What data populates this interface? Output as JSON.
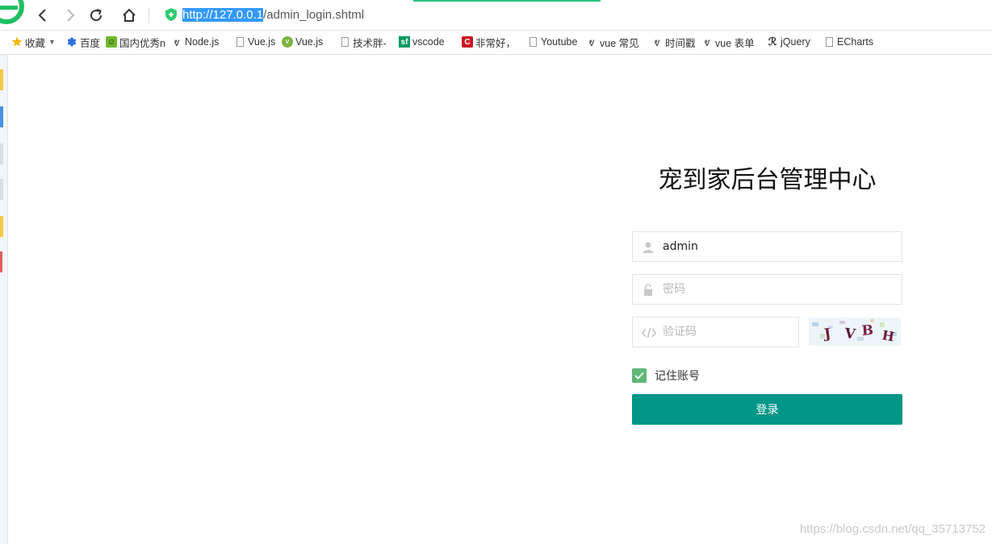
{
  "browser": {
    "url_selected": "http://127.0.0.1",
    "url_rest": "/admin_login.shtml"
  },
  "bookmarks": [
    {
      "label": "收藏",
      "icon": "star-icon"
    },
    {
      "label": "百度",
      "icon": "baidu-paw-icon"
    },
    {
      "label": "国内优秀n",
      "icon": "smiley-icon"
    },
    {
      "label": "Node.js",
      "icon": "v-logo-icon"
    },
    {
      "label": "Vue.js",
      "icon": "page-icon"
    },
    {
      "label": "Vue.js",
      "icon": "vue-logo-icon"
    },
    {
      "label": "技术胖-",
      "icon": "page-icon"
    },
    {
      "label": "vscode",
      "icon": "sf-logo-icon"
    },
    {
      "label": "非常好，",
      "icon": "c-logo-icon"
    },
    {
      "label": "Youtube",
      "icon": "page-icon"
    },
    {
      "label": "vue 常见",
      "icon": "v-logo-icon"
    },
    {
      "label": "时间戳",
      "icon": "v-logo-icon"
    },
    {
      "label": "vue 表单",
      "icon": "v-logo-icon"
    },
    {
      "label": "jQuery",
      "icon": "jquery-logo-icon"
    },
    {
      "label": "ECharts",
      "icon": "page-icon"
    }
  ],
  "login": {
    "title": "宠到家后台管理中心",
    "username_value": "admin",
    "password_placeholder": "密码",
    "captcha_placeholder": "验证码",
    "captcha_text": "JVBH",
    "remember_label": "记住账号",
    "remember_checked": true,
    "submit_label": "登录"
  },
  "watermark": "https://blog.csdn.net/qq_35713752",
  "colors": {
    "primary_button": "#009688",
    "checkbox": "#5fb878",
    "url_highlight": "#3399ff"
  }
}
